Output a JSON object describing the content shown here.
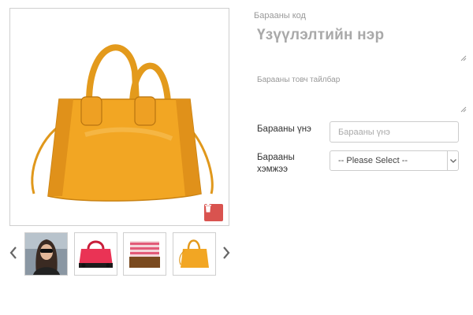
{
  "gallery": {
    "main_image_icon": "yellow-handbag-image",
    "delete_icon": "trash-icon",
    "prev_icon": "chevron-left-icon",
    "next_icon": "chevron-right-icon",
    "thumbnails": [
      {
        "icon": "woman-sunglasses-image"
      },
      {
        "icon": "pink-handbag-image"
      },
      {
        "icon": "striped-clutch-image"
      },
      {
        "icon": "yellow-handbag-image"
      }
    ]
  },
  "form": {
    "code_label": "Барааны код",
    "name_value": "Үзүүлэлтийн нэр",
    "description_placeholder": "Барааны товч тайлбар",
    "price_label": "Барааны үнэ",
    "price_placeholder": "Барааны үнэ",
    "size_label": "Барааны хэмжээ",
    "size_selected": "-- Please Select --"
  },
  "colors": {
    "delete_button": "#d9534f",
    "handbag": "#f0a82a"
  }
}
